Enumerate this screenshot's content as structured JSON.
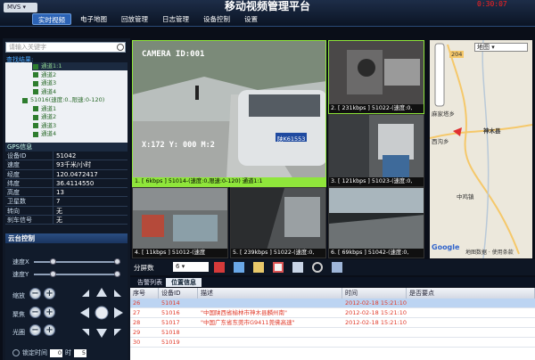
{
  "app": {
    "brand": "MVS",
    "title": "移动视频管理平台",
    "clock": "0:30:07"
  },
  "menu": [
    {
      "label": "实时视频",
      "active": true
    },
    {
      "label": "电子地图",
      "active": false
    },
    {
      "label": "回放管理",
      "active": false
    },
    {
      "label": "日志管理",
      "active": false
    },
    {
      "label": "设备控制",
      "active": false
    },
    {
      "label": "设置",
      "active": false
    }
  ],
  "search": {
    "placeholder": "请输入关键字",
    "results_label": "查找结果:"
  },
  "tree": [
    {
      "label": "通道1:1",
      "indent": 40,
      "selected": true
    },
    {
      "label": "通道2",
      "indent": 40,
      "selected": false
    },
    {
      "label": "通道3",
      "indent": 40,
      "selected": false
    },
    {
      "label": "通道4",
      "indent": 40,
      "selected": false
    },
    {
      "label": "51016(速度:0.,限速:0-120)",
      "indent": 28,
      "selected": false
    },
    {
      "label": "通道1",
      "indent": 40,
      "selected": false
    },
    {
      "label": "通道2",
      "indent": 40,
      "selected": false
    },
    {
      "label": "通道3",
      "indent": 40,
      "selected": false
    },
    {
      "label": "通道4",
      "indent": 40,
      "selected": false
    }
  ],
  "gps": {
    "title": "GPS信息",
    "rows": [
      {
        "k": "设备ID",
        "v": "51042"
      },
      {
        "k": "速度",
        "v": "93千米/小时"
      },
      {
        "k": "经度",
        "v": "120.0472417"
      },
      {
        "k": "纬度",
        "v": "36.4114550"
      },
      {
        "k": "高度",
        "v": "13"
      },
      {
        "k": "卫星数",
        "v": "7"
      },
      {
        "k": "转向",
        "v": "无"
      },
      {
        "k": "刹车信号",
        "v": "无"
      }
    ]
  },
  "ptz": {
    "title": "云台控制",
    "speed_x": "速度X",
    "speed_y": "速度Y",
    "zoom": "缩放",
    "focus": "聚焦",
    "iris": "光圈",
    "lock_label": "锁定时间",
    "lock_h": "0",
    "lock_unit": "时",
    "lock_m": "5"
  },
  "videos": [
    {
      "label": "1. [ 6kbps ] 51014-(速度:0,限速:0-120) 通道1:1",
      "overlay_top": "CAMERA ID:001",
      "overlay_bottom": "X:172 Y: 000  M:2",
      "plate": "陕K61553",
      "highlight": true
    },
    {
      "label": "2. [ 231kbps ] 51022-(速度:0,",
      "highlight": false
    },
    {
      "label": "3. [ 121kbps ] 51023-(速度:0,",
      "highlight": false
    },
    {
      "label": "4. [ 11kbps ] 51012-(速度",
      "highlight": false
    },
    {
      "label": "5. [ 239kbps ] 51022-(速度:0,",
      "highlight": false
    },
    {
      "label": "6. [ 69kbps ] 51042-(速度:0,",
      "highlight": false
    }
  ],
  "map": {
    "type_select": "地图",
    "places": [
      "麻家塔乡",
      "神木县",
      "西沟乡",
      "中鸡镇"
    ],
    "road": "204",
    "provider": "Google",
    "footer": "地图数据 · 使用条款"
  },
  "toolbar": {
    "split_label": "分屏数",
    "split_value": "6"
  },
  "tabs": [
    {
      "label": "告警列表",
      "active": false
    },
    {
      "label": "位置信息",
      "active": true
    }
  ],
  "table": {
    "columns": [
      "序号",
      "设备ID",
      "描述",
      "时间",
      "是否要点"
    ],
    "rows": [
      {
        "seq": "26",
        "id": "51014",
        "desc": "",
        "time": "2012-02-18 15:21:10"
      },
      {
        "seq": "27",
        "id": "51016",
        "desc": "\"中国陕西省榆林市神木县麟州南\"",
        "time": "2012-02-18 15:21:10"
      },
      {
        "seq": "28",
        "id": "51017",
        "desc": "\"中国广东省东莞市G9411莞佛高速\"",
        "time": "2012-02-18 15:21:10"
      },
      {
        "seq": "29",
        "id": "51018",
        "desc": "",
        "time": ""
      },
      {
        "seq": "30",
        "id": "51019",
        "desc": "",
        "time": ""
      }
    ]
  },
  "colors": {
    "accent": "#2c63b5",
    "highlight_label": "#8fe63b",
    "alert_text": "#e03a2a",
    "clock": "#ff2020"
  }
}
